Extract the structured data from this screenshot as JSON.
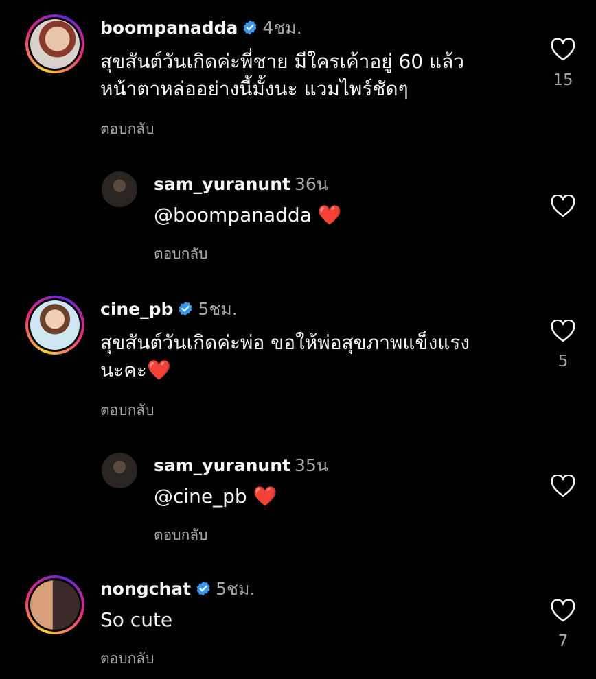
{
  "comments": [
    {
      "username": "boompanadda",
      "verified": true,
      "time": "4ชม.",
      "text": "สุขสันต์วันเกิดค่ะพี่ชาย มีใครเค้าอยู่ 60 แล้ว\nหน้าตาหล่ออย่างนี้มั้งนะ แวมไพร์ชัดๆ",
      "reply_label": "ตอบกลับ",
      "likes": "15"
    },
    {
      "username": "sam_yuranunt",
      "verified": false,
      "time": "36น",
      "text": "@boompanadda ❤️",
      "reply_label": "ตอบกลับ",
      "likes": ""
    },
    {
      "username": "cine_pb",
      "verified": true,
      "time": "5ชม.",
      "text": "สุขสันต์วันเกิดค่ะพ่อ ขอให้พ่อสุขภาพแข็งแรง\nนะคะ❤️",
      "reply_label": "ตอบกลับ",
      "likes": "5"
    },
    {
      "username": "sam_yuranunt",
      "verified": false,
      "time": "35น",
      "text": "@cine_pb ❤️",
      "reply_label": "ตอบกลับ",
      "likes": ""
    },
    {
      "username": "nongchat",
      "verified": true,
      "time": "5ชม.",
      "text": "So cute",
      "reply_label": "ตอบกลับ",
      "likes": "7"
    }
  ],
  "colors": {
    "background": "#000000",
    "text": "#f5f5f5",
    "muted": "#a8a8a8",
    "verified": "#3897f0"
  },
  "icons": [
    "heart-outline-icon",
    "verified-badge-icon"
  ]
}
